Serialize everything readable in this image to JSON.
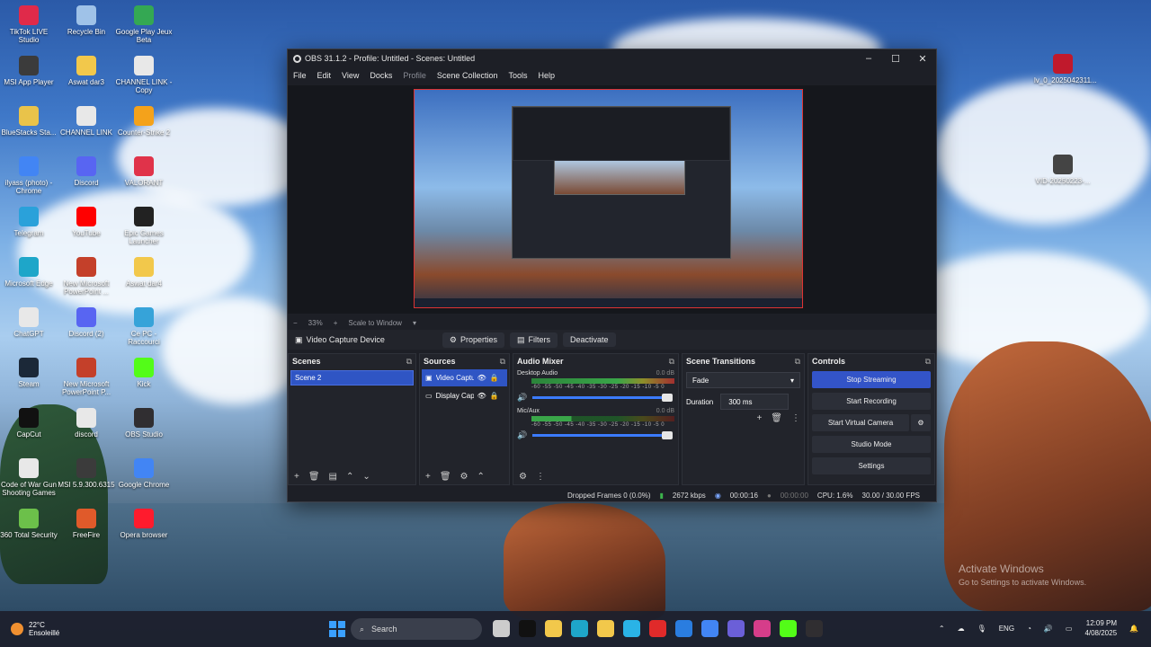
{
  "desktop": {
    "icons": [
      {
        "label": "TikTok LIVE Studio",
        "color": "#e02a4a"
      },
      {
        "label": "Recycle Bin",
        "color": "#9fc2e8"
      },
      {
        "label": "Google Play Jeux Beta",
        "color": "#34a853"
      },
      {
        "label": "MSI App Player",
        "color": "#3b3b3b"
      },
      {
        "label": "Aswat dar3",
        "color": "#f2c84b"
      },
      {
        "label": "CHANNEL LINK - Copy",
        "color": "#e8e8e8"
      },
      {
        "label": "BlueStacks Sta...",
        "color": "#e9c34a"
      },
      {
        "label": "CHANNEL LINK",
        "color": "#e8e8e8"
      },
      {
        "label": "Counter-Strike 2",
        "color": "#f4a21b"
      },
      {
        "label": "ilyass (photo) - Chrome",
        "color": "#4285f4"
      },
      {
        "label": "Discord",
        "color": "#5865f2"
      },
      {
        "label": "VALORANT",
        "color": "#e0334a"
      },
      {
        "label": "Telegram",
        "color": "#2aa1da"
      },
      {
        "label": "YouTube",
        "color": "#ff0000"
      },
      {
        "label": "Epic Games Launcher",
        "color": "#222222"
      },
      {
        "label": "Microsoft Edge",
        "color": "#1ea6c9"
      },
      {
        "label": "New Microsoft PowerPoint ...",
        "color": "#c4402a"
      },
      {
        "label": "Aswat dar4",
        "color": "#f2c84b"
      },
      {
        "label": "ChatGPT",
        "color": "#e8e8e8"
      },
      {
        "label": "Discord (2)",
        "color": "#5865f2"
      },
      {
        "label": "Ce PC - Raccourci",
        "color": "#36a3d9"
      },
      {
        "label": "Steam",
        "color": "#1b2838"
      },
      {
        "label": "New Microsoft PowerPoint P...",
        "color": "#c4402a"
      },
      {
        "label": "Kick",
        "color": "#53fc18"
      },
      {
        "label": "CapCut",
        "color": "#111111"
      },
      {
        "label": "discord",
        "color": "#e8e8e8"
      },
      {
        "label": "OBS Studio",
        "color": "#302e31"
      },
      {
        "label": "Code of War Gun Shooting Games",
        "color": "#e8e8e8"
      },
      {
        "label": "MSI 5.9.300.6315",
        "color": "#3b3b3b"
      },
      {
        "label": "Google Chrome",
        "color": "#4285f4"
      },
      {
        "label": "360 Total Security",
        "color": "#6cc04a"
      },
      {
        "label": "FreeFire",
        "color": "#e05a2a"
      },
      {
        "label": "Opera browser",
        "color": "#ff1b2d"
      }
    ],
    "right_icons": [
      {
        "label": "lv_0_2025042311...",
        "color": "#c0192c"
      },
      {
        "label": "VID-20250223-...",
        "color": "#444444"
      }
    ],
    "activate_title": "Activate Windows",
    "activate_sub": "Go to Settings to activate Windows."
  },
  "obs": {
    "title": "OBS 31.1.2 - Profile: Untitled - Scenes: Untitled",
    "menu": [
      "File",
      "Edit",
      "View",
      "Docks",
      "Profile",
      "Scene Collection",
      "Tools",
      "Help"
    ],
    "zoom": "33%",
    "scale_mode": "Scale to Window",
    "source_name": "Video Capture Device",
    "properties": "Properties",
    "filters": "Filters",
    "deactivate": "Deactivate",
    "scenes_title": "Scenes",
    "scenes": [
      "Scene 2"
    ],
    "sources_title": "Sources",
    "sources": [
      "Video Capture Device",
      "Display Capture"
    ],
    "mixer_title": "Audio Mixer",
    "mixer": [
      {
        "name": "Desktop Audio",
        "db": "0.0 dB",
        "level": 0.92
      },
      {
        "name": "Mic/Aux",
        "db": "0.0 dB",
        "level": 0.28
      }
    ],
    "meter_scale": "-60 -55 -50 -45 -40 -35 -30 -25 -20 -15 -10 -5 0",
    "transitions_title": "Scene Transitions",
    "transition": "Fade",
    "duration_label": "Duration",
    "duration": "300 ms",
    "controls_title": "Controls",
    "controls": [
      "Stop Streaming",
      "Start Recording",
      "Start Virtual Camera",
      "Studio Mode",
      "Settings"
    ],
    "status": {
      "dropped": "Dropped Frames 0 (0.0%)",
      "kbps": "2672 kbps",
      "stream_time": "00:00:16",
      "rec_time": "00:00:00",
      "cpu": "CPU: 1.6%",
      "fps": "30.00 / 30.00 FPS"
    }
  },
  "taskbar": {
    "temp": "22°C",
    "weather": "Ensoleillé",
    "search": "Search",
    "lang": "ENG",
    "time": "12:09 PM",
    "date": "4/08/2025",
    "apps": [
      "#cccccc",
      "#111111",
      "#f2c84b",
      "#1ea6c9",
      "#f2c84b",
      "#2ab3e6",
      "#e02a2a",
      "#2a7de0",
      "#4285f4",
      "#6b5fd8",
      "#d63d8a",
      "#53fc18",
      "#302e31"
    ]
  }
}
